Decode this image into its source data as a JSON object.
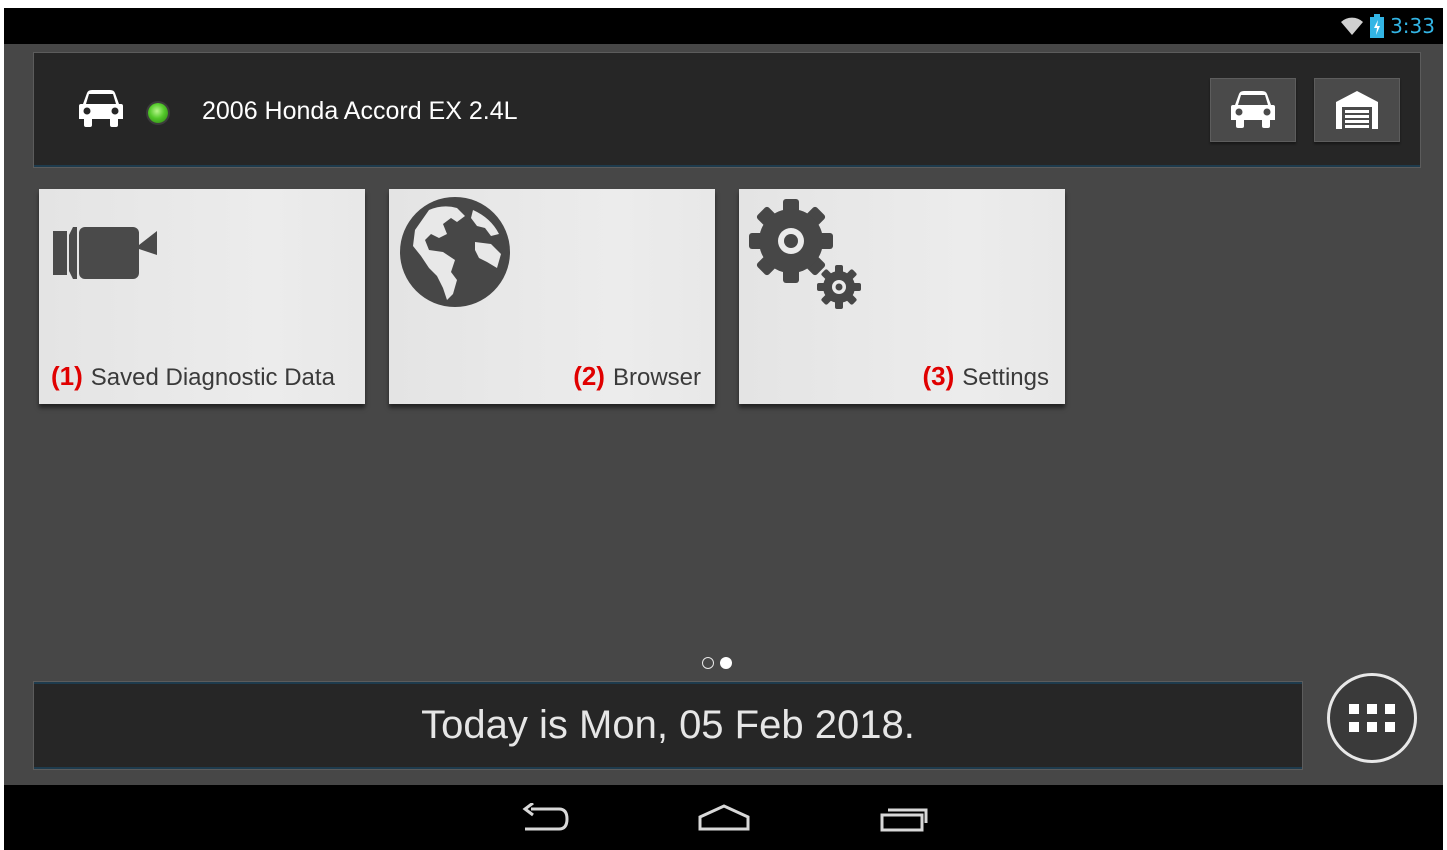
{
  "status_bar": {
    "time": "3:33",
    "wifi_icon": "wifi-icon",
    "battery_icon": "battery-charging-icon",
    "accent_color": "#33b5e5"
  },
  "vehicle_bar": {
    "vehicle_icon": "car-icon",
    "connection_status": "connected",
    "status_color": "#53c92a",
    "vehicle_name": "2006 Honda Accord EX 2.4L",
    "buttons": [
      {
        "name": "vehicle-button",
        "icon": "car-icon"
      },
      {
        "name": "garage-button",
        "icon": "garage-icon"
      }
    ]
  },
  "tiles": [
    {
      "number": "(1)",
      "label": "Saved Diagnostic Data",
      "icon": "video-camera-icon"
    },
    {
      "number": "(2)",
      "label": "Browser",
      "icon": "globe-icon"
    },
    {
      "number": "(3)",
      "label": "Settings",
      "icon": "gears-icon"
    }
  ],
  "page_indicator": {
    "pages": 2,
    "current": 2
  },
  "date_bar": {
    "text": "Today is Mon, 05 Feb 2018."
  },
  "apps_button": {
    "icon": "apps-grid-icon"
  },
  "nav_bar": {
    "buttons": [
      {
        "name": "back-button",
        "icon": "back-icon"
      },
      {
        "name": "home-button",
        "icon": "home-icon"
      },
      {
        "name": "recents-button",
        "icon": "recents-icon"
      }
    ]
  },
  "colors": {
    "tile_number": "#e00000",
    "background": "#474747"
  }
}
